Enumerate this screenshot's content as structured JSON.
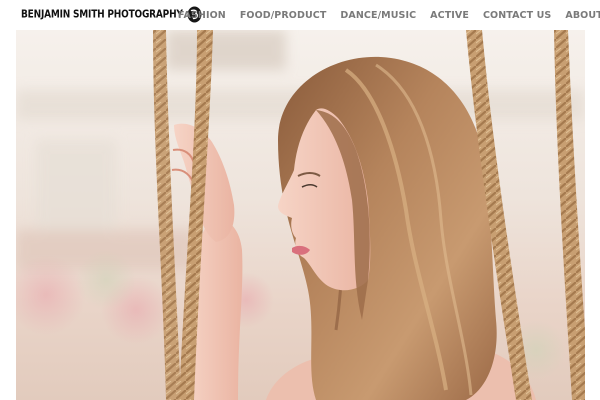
{
  "site": {
    "brand_name": "BENJAMIN SMITH PHOTOGRAPHY",
    "brand_mark_icon": "monogram-logo-icon"
  },
  "nav": {
    "items": [
      {
        "label": "FASHION"
      },
      {
        "label": "FOOD/PRODUCT"
      },
      {
        "label": "DANCE/MUSIC"
      },
      {
        "label": "ACTIVE"
      },
      {
        "label": "CONTACT US"
      },
      {
        "label": "ABOUT"
      }
    ]
  },
  "hero": {
    "image_icon": "portrait-photo",
    "colors": {
      "background": "#f1e9e3",
      "hair": "#a7744e",
      "skin": "#f0c2b1",
      "rope": "#c49a6c"
    }
  }
}
